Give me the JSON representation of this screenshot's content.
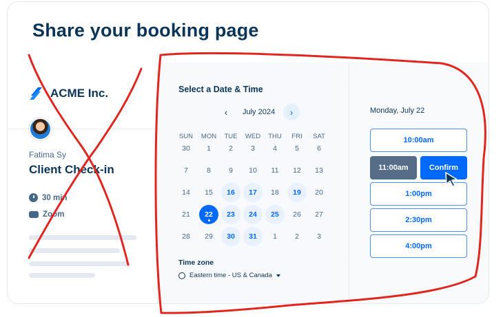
{
  "title": "Share your booking page",
  "sidebar": {
    "brand": "ACME Inc.",
    "host_name": "Fatima Sy",
    "event_name": "Client Check-in",
    "duration": "30 min",
    "location": "Zoom"
  },
  "calendar": {
    "heading": "Select a Date & Time",
    "month": "July 2024",
    "weekdays": [
      "SUN",
      "MON",
      "TUE",
      "WED",
      "THU",
      "FRI",
      "SAT"
    ],
    "weeks": [
      [
        "30",
        "1",
        "2",
        "3",
        "4",
        "5",
        "6"
      ],
      [
        "7",
        "8",
        "9",
        "10",
        "11",
        "12",
        "13"
      ],
      [
        "14",
        "15",
        "16",
        "17",
        "18",
        "19",
        "20"
      ],
      [
        "21",
        "22",
        "23",
        "24",
        "25",
        "26",
        "27"
      ],
      [
        "28",
        "29",
        "30",
        "31",
        "1",
        "2",
        "3"
      ]
    ],
    "available_days": [
      "16",
      "17",
      "19",
      "23",
      "24",
      "25",
      "30",
      "31"
    ],
    "selected_day": "22",
    "timezone_label": "Time zone",
    "timezone_value": "Eastern time - US & Canada"
  },
  "slots": {
    "date": "Monday, July 22",
    "times": [
      "10:00am",
      "1:00pm",
      "2:30pm",
      "4:00pm"
    ],
    "selected_time": "11:00am",
    "confirm_label": "Confirm"
  },
  "colors": {
    "accent": "#0069ff",
    "text": "#0b3558",
    "annotation": "#e0261f"
  },
  "icons": [
    "acme-logo-icon",
    "clock-icon",
    "video-icon",
    "chevron-left-icon",
    "chevron-right-icon",
    "globe-icon",
    "caret-down-icon",
    "cursor-icon"
  ]
}
